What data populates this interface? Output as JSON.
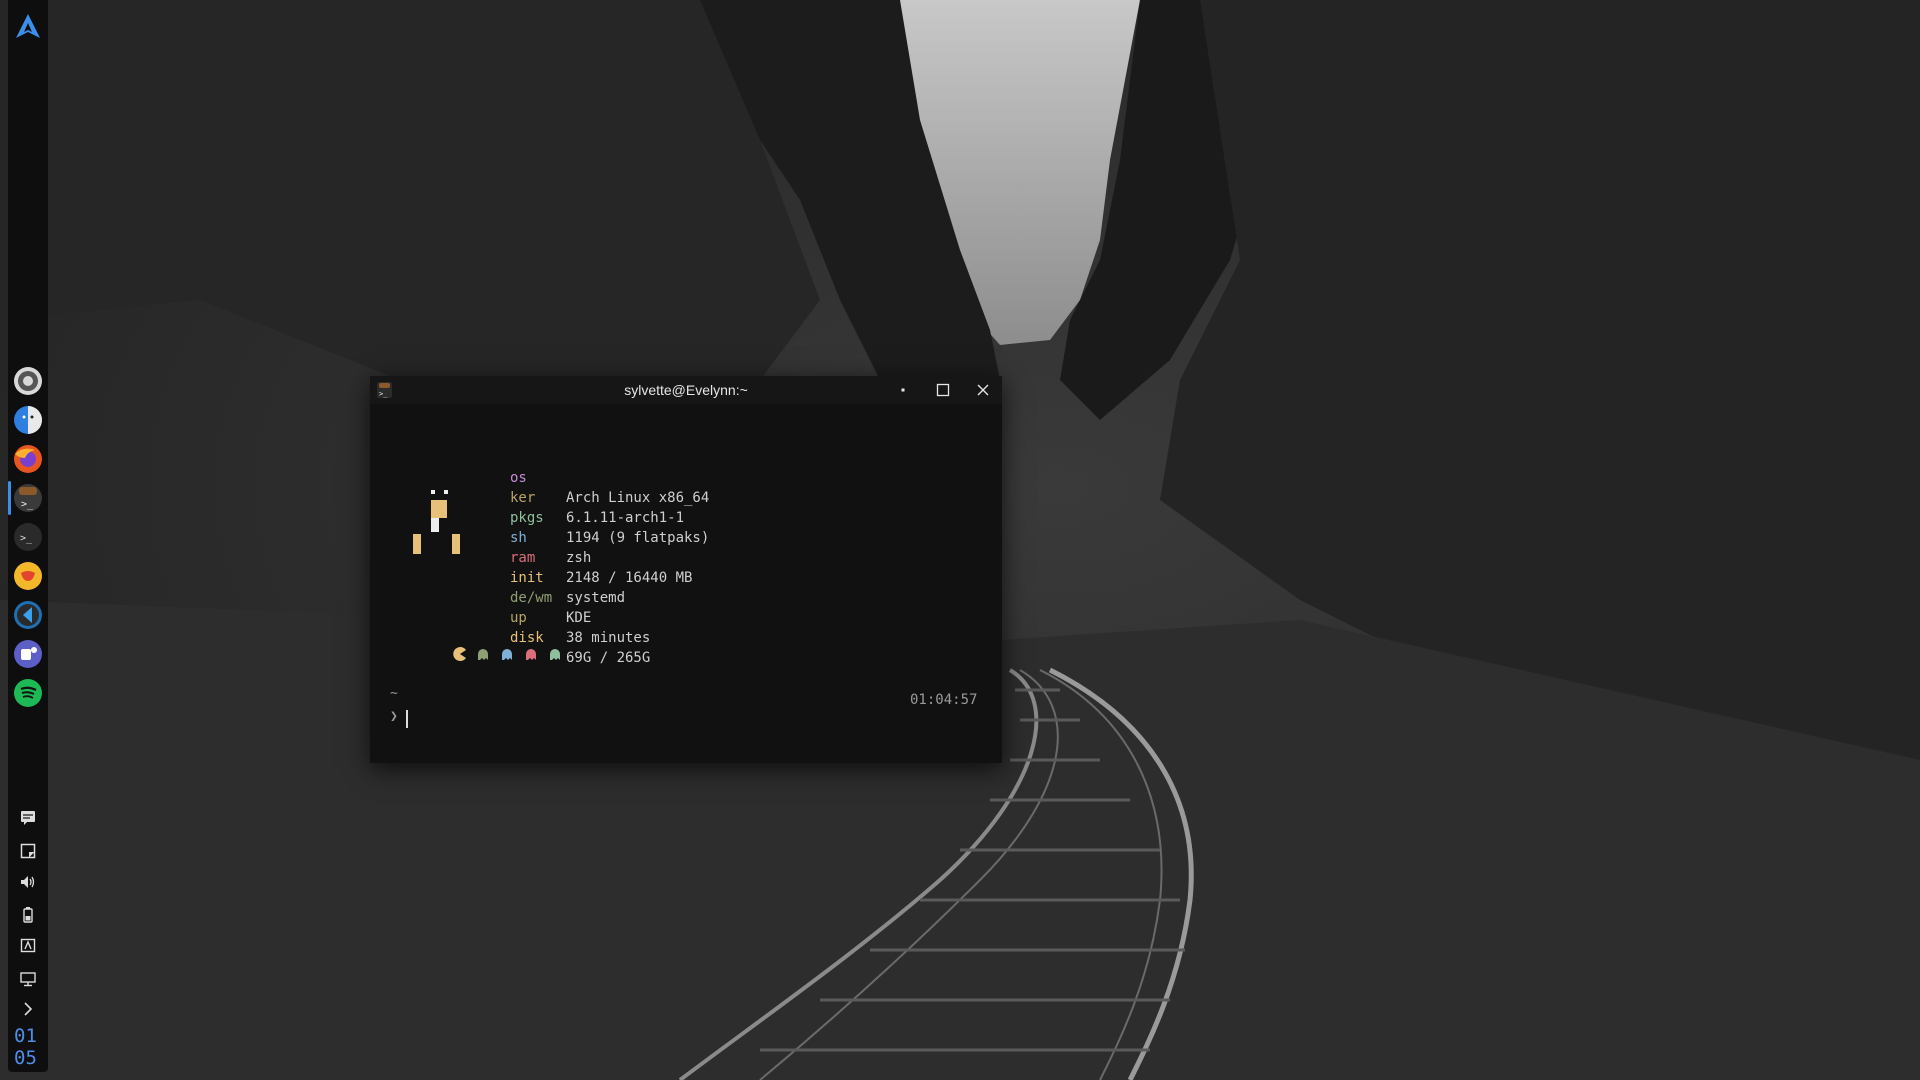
{
  "window": {
    "title": "sylvette@Evelynn:~"
  },
  "fetch": {
    "rows": [
      {
        "key": "os",
        "value": "Arch Linux x86_64",
        "color": "#c78bd8"
      },
      {
        "key": "ker",
        "value": "6.1.11-arch1-1",
        "color": "#b9a46a"
      },
      {
        "key": "pkgs",
        "value": "1194 (9 flatpaks)",
        "color": "#8fbf9c"
      },
      {
        "key": "sh",
        "value": "zsh",
        "color": "#7fb0d8"
      },
      {
        "key": "ram",
        "value": "2148 / 16440 MB",
        "color": "#d86f7a"
      },
      {
        "key": "init",
        "value": "systemd",
        "color": "#e7c17a"
      },
      {
        "key": "de/wm",
        "value": "KDE",
        "color": "#8f9f73"
      },
      {
        "key": "up",
        "value": "38 minutes",
        "color": "#b9a46a"
      },
      {
        "key": "disk",
        "value": "69G / 265G",
        "color": "#e7c17a"
      }
    ]
  },
  "shell": {
    "cwd": "~",
    "prompt": "❯",
    "time": "01:04:57"
  },
  "clock": {
    "hour": "01",
    "minute": "05"
  },
  "colors": {
    "accent": "#3b8eea",
    "terminal_bg": "#111111",
    "titlebar_bg": "#161616",
    "panel_bg": "#0e0e0e"
  },
  "panel": {
    "launcher_icon": "arch-logo-icon",
    "tasks": [
      "settings-icon",
      "finder-icon",
      "firefox-icon",
      "konsole-icon",
      "terminal-icon",
      "chat-bot-icon",
      "vscode-icon",
      "teams-icon",
      "spotify-icon"
    ],
    "tray": [
      "notifications-icon",
      "notes-icon",
      "volume-icon",
      "battery-icon",
      "display-icon",
      "kde-connect-icon",
      "expand-arrow-icon"
    ]
  }
}
